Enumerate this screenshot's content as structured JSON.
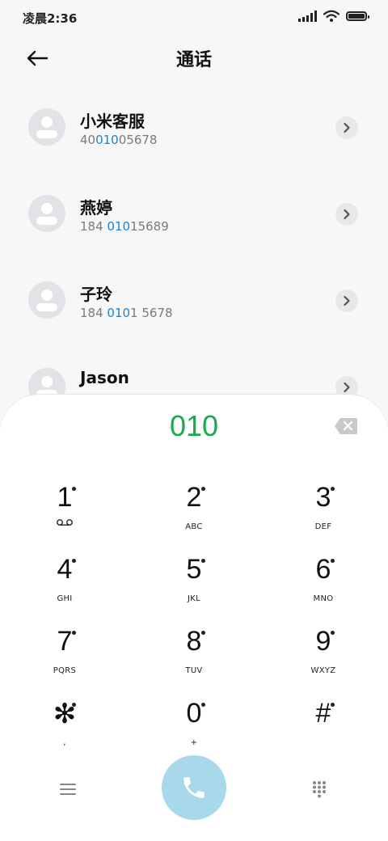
{
  "status_bar": {
    "time": "凌晨2:36"
  },
  "header": {
    "title": "通话"
  },
  "contacts": [
    {
      "name": "小米客服",
      "number_pre": "40",
      "number_match": "010",
      "number_post": "05678"
    },
    {
      "name": "燕婷",
      "number_pre": "184 ",
      "number_match": "010",
      "number_post": "15689"
    },
    {
      "name": "子玲",
      "number_pre": "184 ",
      "number_match": "010",
      "number_post": "1 5678"
    },
    {
      "name": "Jason",
      "number_pre": "",
      "number_match": "",
      "number_post": ""
    }
  ],
  "dialer": {
    "input": "010",
    "keys": [
      {
        "digit": "1",
        "letters": ""
      },
      {
        "digit": "2",
        "letters": "ABC"
      },
      {
        "digit": "3",
        "letters": "DEF"
      },
      {
        "digit": "4",
        "letters": "GHI"
      },
      {
        "digit": "5",
        "letters": "JKL"
      },
      {
        "digit": "6",
        "letters": "MNO"
      },
      {
        "digit": "7",
        "letters": "PQRS"
      },
      {
        "digit": "8",
        "letters": "TUV"
      },
      {
        "digit": "9",
        "letters": "WXYZ"
      },
      {
        "digit": "✻",
        "letters": ","
      },
      {
        "digit": "0",
        "letters": "+"
      },
      {
        "digit": "#",
        "letters": ""
      }
    ]
  },
  "icons": {
    "back": "arrow-left-icon",
    "detail": "chevron-right-icon",
    "delete": "backspace-icon",
    "voicemail": "voicemail-icon",
    "menu": "menu-icon",
    "call": "phone-icon",
    "keypad": "dialpad-icon"
  },
  "colors": {
    "accent_blue": "#1b83d6",
    "dial_green": "#1aab4f",
    "call_button": "#a8d9ea"
  }
}
